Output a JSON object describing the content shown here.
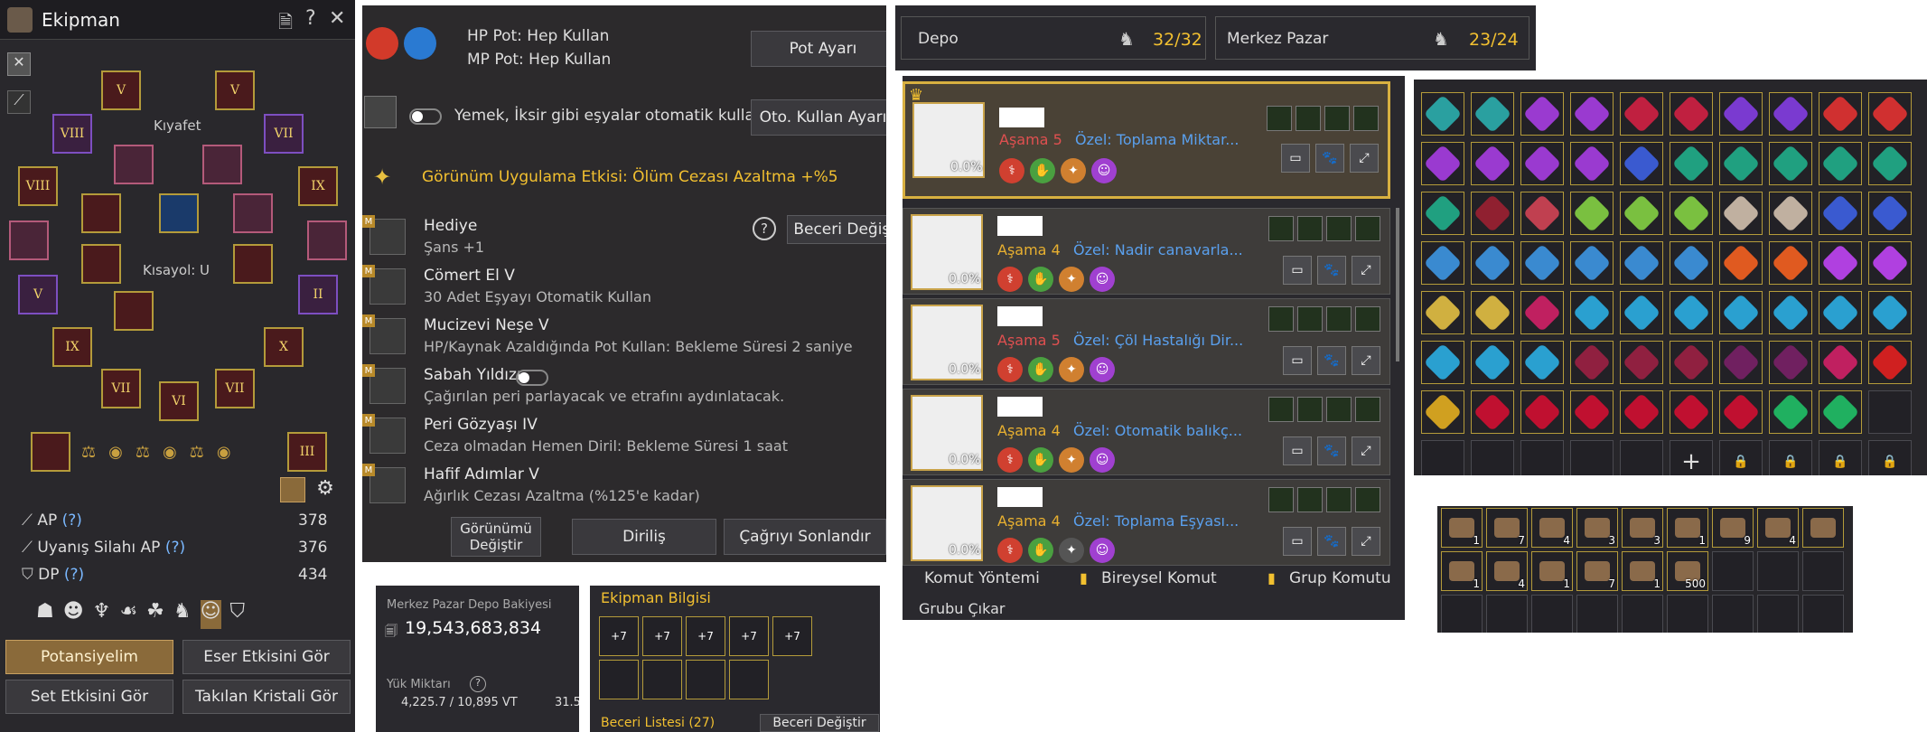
{
  "equipment": {
    "title": "Ekipman",
    "clothing_label": "Kıyafet",
    "shortcut_label": "Kısayol: U",
    "slot_labels": [
      "V",
      "V",
      "VIII",
      "VII",
      "VIII",
      "IX",
      "V",
      "II",
      "IX",
      "X",
      "VII",
      "VI",
      "VII",
      "III"
    ],
    "stats": [
      {
        "label": "AP",
        "help": "(?)",
        "value": "378"
      },
      {
        "label": "Uyanış Silahı AP",
        "help": "(?)",
        "value": "376"
      },
      {
        "label": "DP",
        "help": "(?)",
        "value": "434"
      }
    ],
    "buttons": {
      "potential": "Potansiyelim",
      "artifact": "Eser Etkisini Gör",
      "set": "Set Etkisini Gör",
      "crystal": "Takılan Kristali Gör"
    }
  },
  "pet_settings": {
    "hp_pot": "HP Pot: Hep Kullan",
    "mp_pot": "MP Pot: Hep Kullan",
    "pot_button": "Pot Ayarı",
    "auto_text": "Yemek, İksir gibi eşyalar otomatik kullanılır.",
    "auto_button": "Oto. Kullan Ayarı",
    "appearance_effect": "Görünüm Uygulama Etkisi: Ölüm Cezası Azaltma +%5",
    "skill_change_button": "Beceri Değiştir",
    "help": "?",
    "abilities": [
      {
        "title": "Hediye",
        "desc": "Şans +1"
      },
      {
        "title": "Cömert El V",
        "desc": "30 Adet Eşyayı Otomatik Kullan"
      },
      {
        "title": "Mucizevi Neşe V",
        "desc": "HP/Kaynak Azaldığında Pot Kullan: Bekleme Süresi 2 saniye"
      },
      {
        "title": "Sabah Yıldızı",
        "desc": "Çağırılan peri parlayacak ve etrafını aydınlatacak."
      },
      {
        "title": "Peri Gözyaşı IV",
        "desc": "Ceza olmadan Hemen Diril: Bekleme Süresi 1 saat"
      },
      {
        "title": "Hafif Adımlar V",
        "desc": "Ağırlık Cezası Azaltma (%125'e kadar)"
      }
    ],
    "bottom_buttons": {
      "appearance": "Görünümü Değiştir",
      "revive": "Diriliş",
      "end_call": "Çağrıyı Sonlandır"
    }
  },
  "storage": {
    "title": "Merkez Pazar Depo Bakiyesi",
    "balance": "19,543,683,834",
    "weight_label": "Yük Miktarı",
    "weight_help": "?",
    "weight": "4,225.7 / 10,895 VT",
    "other": "31.5"
  },
  "equip_info": {
    "title": "Ekipman Bilgisi",
    "enchants": [
      "+7",
      "+7",
      "+7",
      "+7",
      "+7"
    ],
    "skill_list": "Beceri Listesi (27)",
    "skill_change": "Beceri Değiştir"
  },
  "top_bar": {
    "depo_label": "Depo",
    "depo_count": "32/32",
    "market_label": "Merkez Pazar",
    "market_count": "23/24"
  },
  "pets": [
    {
      "stage_label": "Aşama",
      "stage": "5",
      "special": "Özel: Toplama Miktar...",
      "percent": "0.0%",
      "stage_color": "#e05050"
    },
    {
      "stage_label": "Aşama",
      "stage": "4",
      "special": "Özel: Nadir canavarla...",
      "percent": "0.0%",
      "stage_color": "#e8b030"
    },
    {
      "stage_label": "Aşama",
      "stage": "5",
      "special": "Özel: Çöl Hastalığı Dir...",
      "percent": "0.0%",
      "stage_color": "#e05050"
    },
    {
      "stage_label": "Aşama",
      "stage": "4",
      "special": "Özel: Otomatik balıkç...",
      "percent": "0.0%",
      "stage_color": "#e8b030"
    },
    {
      "stage_label": "Aşama",
      "stage": "4",
      "special": "Özel: Toplama Eşyası...",
      "percent": "0.0%",
      "stage_color": "#e8b030"
    }
  ],
  "pet_commands": {
    "method": "Komut Yöntemi",
    "individual": "Bireysel Komut",
    "group": "Grup Komutu",
    "leave": "Grubu Çıkar"
  },
  "inventory": {
    "add": "+",
    "colors": [
      "#2aa0a0",
      "#2aa0a0",
      "#9a3ad0",
      "#9a3ad0",
      "#c02040",
      "#c02040",
      "#7a3ad0",
      "#7a3ad0",
      "#d03030",
      "#d03030",
      "#9a3ad0",
      "#9a3ad0",
      "#9a3ad0",
      "#9a3ad0",
      "#3a5ad0",
      "#20a080",
      "#20a080",
      "#20a080",
      "#20a080",
      "#20a080",
      "#20a080",
      "#902030",
      "#c04050",
      "#7ac040",
      "#7ac040",
      "#7ac040",
      "#c0b0a0",
      "#c0b0a0",
      "#3a5ad0",
      "#3a5ad0",
      "#3a8ad0",
      "#3a8ad0",
      "#3a8ad0",
      "#3a8ad0",
      "#3a8ad0",
      "#3a8ad0",
      "#e05a20",
      "#e05a20",
      "#b040e0",
      "#b040e0",
      "#d0b040",
      "#d0b040",
      "#c02060",
      "#2aa0d0",
      "#2aa0d0",
      "#2aa0d0",
      "#2aa0d0",
      "#2aa0d0",
      "#2aa0d0",
      "#2aa0d0",
      "#2aa0d0",
      "#2aa0d0",
      "#2aa0d0",
      "#902040",
      "#902040",
      "#902040",
      "#702060",
      "#702060",
      "#c02060",
      "#d02020",
      "#d0a020",
      "#c01030",
      "#c01030",
      "#c01030",
      "#c01030",
      "#c01030",
      "#c01030",
      "#20b060",
      "#20b060",
      ""
    ]
  },
  "small_inventory": {
    "counts": [
      "1",
      "7",
      "4",
      "3",
      "3",
      "1",
      "9",
      "4",
      "",
      "1",
      "4",
      "1",
      "7",
      "1",
      "500"
    ]
  }
}
